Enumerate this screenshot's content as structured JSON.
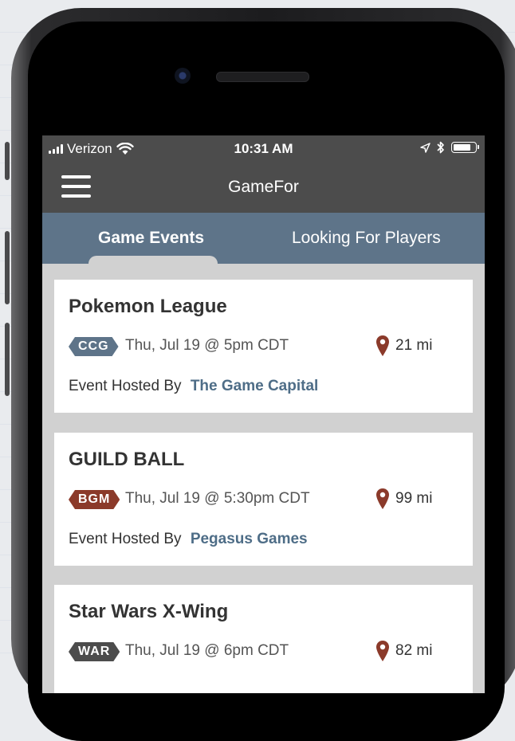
{
  "status_bar": {
    "carrier": "Verizon",
    "time": "10:31 AM",
    "battery_level": 0.85
  },
  "app_bar": {
    "title": "GameFor",
    "menu_icon": "hamburger-icon"
  },
  "tabs": [
    {
      "label": "Game Events",
      "active": true
    },
    {
      "label": "Looking For Players",
      "active": false
    }
  ],
  "events": [
    {
      "title": "Pokemon League",
      "badge": "CCG",
      "badge_color": "#5e7489",
      "datetime": "Thu, Jul 19 @ 5pm CDT",
      "distance": "21 mi",
      "hosted_by_label": "Event Hosted By",
      "host": "The Game Capital"
    },
    {
      "title": "GUILD BALL",
      "badge": "BGM",
      "badge_color": "#8b3a2a",
      "datetime": "Thu, Jul 19 @ 5:30pm CDT",
      "distance": "99 mi",
      "hosted_by_label": "Event Hosted By",
      "host": "Pegasus Games"
    },
    {
      "title": "Star Wars X-Wing",
      "badge": "WAR",
      "badge_color": "#4c4c4c",
      "datetime": "Thu, Jul 19 @ 6pm CDT",
      "distance": "82 mi",
      "hosted_by_label": "",
      "host": ""
    }
  ],
  "colors": {
    "header": "#4c4c4c",
    "tab_bar": "#5e7489",
    "pin": "#8b3a2a",
    "host_link": "#4e6d87"
  }
}
